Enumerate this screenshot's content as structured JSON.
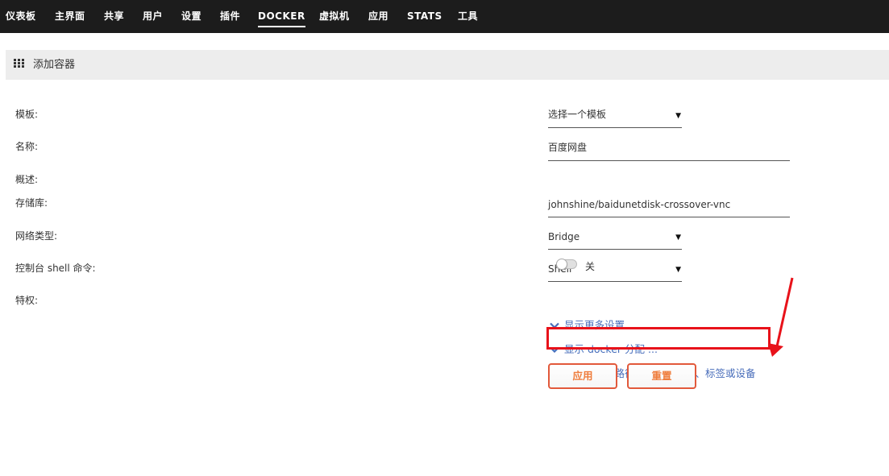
{
  "nav": {
    "items": [
      {
        "label": "仪表板"
      },
      {
        "label": "主界面"
      },
      {
        "label": "共享"
      },
      {
        "label": "用户"
      },
      {
        "label": "设置"
      },
      {
        "label": "插件"
      },
      {
        "label": "DOCKER",
        "active": true
      },
      {
        "label": "虚拟机"
      },
      {
        "label": "应用"
      },
      {
        "label": "STATS"
      },
      {
        "label": "工具"
      }
    ]
  },
  "page": {
    "title": "添加容器",
    "title_icon": "grid-icon"
  },
  "form": {
    "template": {
      "label": "模板:",
      "value": "选择一个模板"
    },
    "name": {
      "label": "名称:",
      "value": "百度网盘"
    },
    "overview": {
      "label": "概述:"
    },
    "repository": {
      "label": "存储库:",
      "value": "johnshine/baidunetdisk-crossover-vnc"
    },
    "network": {
      "label": "网络类型:",
      "value": "Bridge"
    },
    "console": {
      "label": "控制台 shell 命令:",
      "value": "Shell"
    },
    "privileged": {
      "label": "特权:",
      "toggle_label": "关",
      "on": false
    }
  },
  "links": {
    "more_settings": "显示更多设置 ...",
    "docker_alloc": "显示 docker 分配 ...",
    "add_another": "添加另一个路径、端口、变量、标签或设备"
  },
  "buttons": {
    "apply": "应用",
    "reset": "重置"
  },
  "colors": {
    "nav_bg": "#1c1c1c",
    "link": "#486dba",
    "button_text": "#ef7d3c",
    "button_border": "#e2593b",
    "highlight": "#e8121a"
  }
}
